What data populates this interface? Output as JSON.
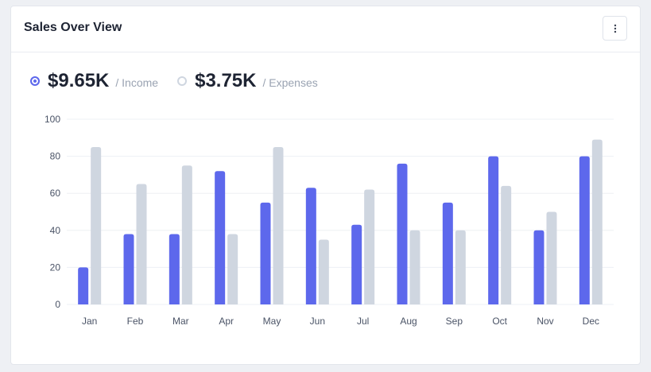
{
  "header": {
    "title": "Sales Over View",
    "menu_icon": "more-vertical-icon"
  },
  "summary": {
    "income": {
      "amount": "$9.65K",
      "label": "/ Income",
      "color": "#5d68ec"
    },
    "expenses": {
      "amount": "$3.75K",
      "label": "/ Expenses",
      "color": "#cfd6e0"
    }
  },
  "chart_data": {
    "type": "bar",
    "categories": [
      "Jan",
      "Feb",
      "Mar",
      "Apr",
      "May",
      "Jun",
      "Jul",
      "Aug",
      "Sep",
      "Oct",
      "Nov",
      "Dec"
    ],
    "series": [
      {
        "name": "Income",
        "color": "#5d68ec",
        "values": [
          20,
          38,
          38,
          72,
          55,
          63,
          43,
          76,
          55,
          80,
          40,
          80
        ]
      },
      {
        "name": "Expenses",
        "color": "#cfd6e0",
        "values": [
          85,
          65,
          75,
          38,
          85,
          35,
          62,
          40,
          40,
          64,
          50,
          89
        ]
      }
    ],
    "yticks": [
      0,
      20,
      40,
      60,
      80,
      100
    ],
    "ylim": [
      0,
      100
    ],
    "grid": true
  }
}
